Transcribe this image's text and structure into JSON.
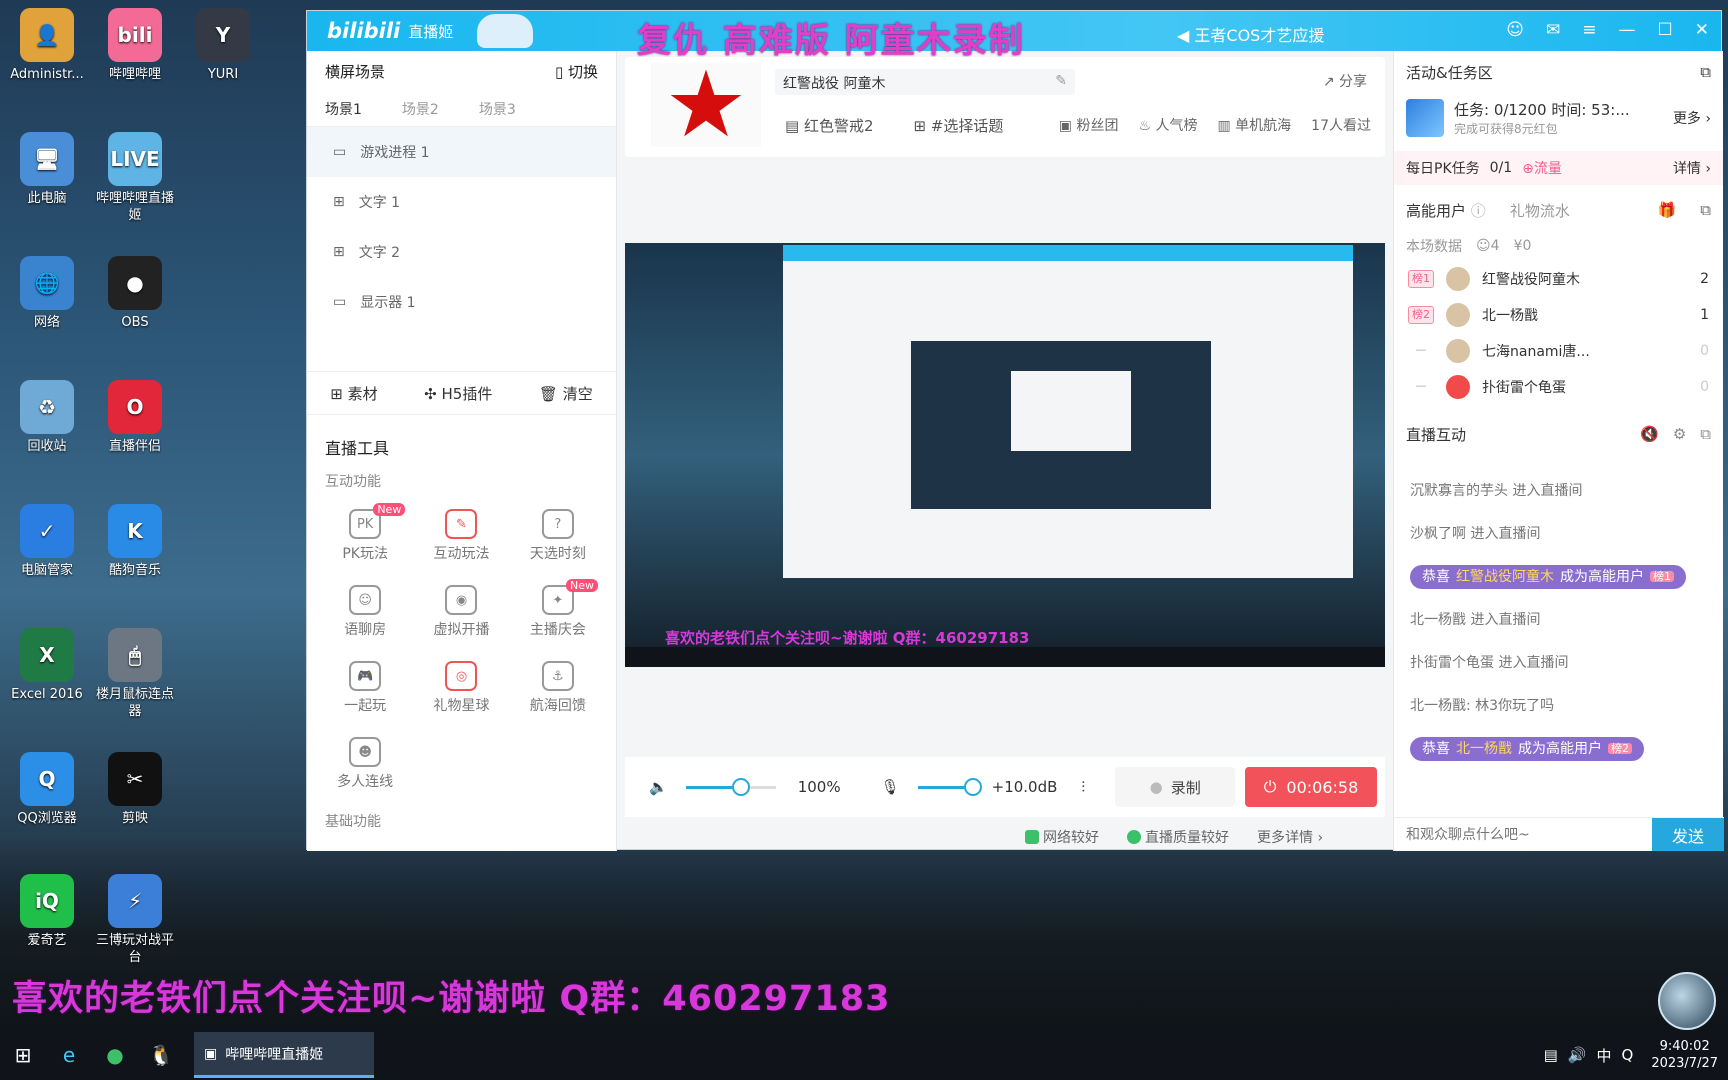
{
  "desktop": {
    "icons": [
      {
        "label": "Administr...",
        "color": "#e2a23b",
        "glyph": "👤"
      },
      {
        "label": "哔哩哔哩",
        "color": "#f36a96",
        "glyph": "bili"
      },
      {
        "label": "YURI",
        "color": "#333a46",
        "glyph": "Y"
      },
      {
        "label": "此电脑",
        "color": "#4a8ed8",
        "glyph": "🖥"
      },
      {
        "label": "哔哩哔哩直播姬",
        "color": "#5fb4e6",
        "glyph": "LIVE"
      },
      {
        "label": "网络",
        "color": "#3a84cf",
        "glyph": "🌐"
      },
      {
        "label": "OBS",
        "color": "#222222",
        "glyph": "●"
      },
      {
        "label": "回收站",
        "color": "#6fa9d6",
        "glyph": "♻"
      },
      {
        "label": "直播伴侣",
        "color": "#e3273a",
        "glyph": "O"
      },
      {
        "label": "电脑管家",
        "color": "#2a7de1",
        "glyph": "✓"
      },
      {
        "label": "酷狗音乐",
        "color": "#2a8be6",
        "glyph": "K"
      },
      {
        "label": "Excel 2016",
        "color": "#1f7a45",
        "glyph": "X"
      },
      {
        "label": "楼月鼠标连点器",
        "color": "#6d7784",
        "glyph": "🖱"
      },
      {
        "label": "QQ浏览器",
        "color": "#2b8fe8",
        "glyph": "Q"
      },
      {
        "label": "剪映",
        "color": "#111111",
        "glyph": "✂"
      },
      {
        "label": "爱奇艺",
        "color": "#1fbf4a",
        "glyph": "iQ"
      },
      {
        "label": "三博玩对战平台",
        "color": "#3c7fd8",
        "glyph": "⚡"
      }
    ],
    "promo": "喜欢的老铁们点个关注呗~谢谢啦 Q群：460297183"
  },
  "taskbar": {
    "app_label": "哔哩哔哩直播姬",
    "tray_ime": "中",
    "time": "9:40:02",
    "date": "2023/7/27"
  },
  "window": {
    "logo": "bilibili",
    "logo_sub": "直播姬",
    "overlay_title": "复仇 高难版 阿童木录制",
    "notice": "王者COS才艺应援"
  },
  "left": {
    "header": "横屏场景",
    "switch_label": "切换",
    "scene_tabs": [
      "场景1",
      "场景2",
      "场景3"
    ],
    "sources": [
      "游戏进程 1",
      "文字 1",
      "文字 2",
      "显示器 1"
    ],
    "source_actions": [
      "素材",
      "H5插件",
      "清空"
    ],
    "tools_title": "直播工具",
    "interactive_title": "互动功能",
    "tools": [
      {
        "label": "PK玩法",
        "glyph": "PK",
        "new": "New"
      },
      {
        "label": "互动玩法",
        "glyph": "✎"
      },
      {
        "label": "天选时刻",
        "glyph": "?"
      },
      {
        "label": "语聊房",
        "glyph": "☺"
      },
      {
        "label": "虚拟开播",
        "glyph": "◉"
      },
      {
        "label": "主播庆会",
        "glyph": "✦",
        "new": "New"
      },
      {
        "label": "一起玩",
        "glyph": "🎮"
      },
      {
        "label": "礼物星球",
        "glyph": "◎"
      },
      {
        "label": "航海回馈",
        "glyph": "⚓"
      },
      {
        "label": "多人连线",
        "glyph": "☻"
      }
    ],
    "basic_title": "基础功能"
  },
  "room": {
    "title": "红警战役 阿童木",
    "share": "分享",
    "category": "红色警戒2",
    "topic": "#选择话题",
    "fans": "粉丝团",
    "popularity": "人气榜",
    "voyage": "单机航海",
    "viewers": "17人看过"
  },
  "preview": {
    "promo": "喜欢的老铁们点个关注呗~谢谢啦 Q群：460297183"
  },
  "controls": {
    "volume": "100%",
    "mic_gain": "+10.0dB",
    "record": "录制",
    "live_time": "00:06:58",
    "network": "网络较好",
    "quality": "直播质量较好",
    "more": "更多详情"
  },
  "right": {
    "activity_title": "活动&任务区",
    "task_text": "任务: 0/1200 时间: 53:...",
    "task_sub": "完成可获得8元红包",
    "more": "更多",
    "pk_label": "每日PK任务",
    "pk_progress": "0/1",
    "pk_reward": "流量",
    "pk_detail": "详情",
    "tab_high": "高能用户",
    "tab_gift": "礼物流水",
    "session_label": "本场数据",
    "session_users": "4",
    "session_money": "¥0",
    "users": [
      {
        "rank": "榜1",
        "name": "红警战役阿童木",
        "count": "2"
      },
      {
        "rank": "榜2",
        "name": "北一杨戬",
        "count": "1"
      },
      {
        "rank": "—",
        "name": "七海nanami唐...",
        "count": "0"
      },
      {
        "rank": "—",
        "name": "扑街雷个龟蛋",
        "count": "0"
      }
    ],
    "interact_title": "直播互动",
    "feed": [
      {
        "type": "text",
        "text": "沉默寡言的芋头 进入直播间"
      },
      {
        "type": "text",
        "text": "沙枫了啊 进入直播间"
      },
      {
        "type": "pill",
        "pre": "恭喜",
        "hl": "红警战役阿童木",
        "post": "成为高能用户",
        "badge": "榜1"
      },
      {
        "type": "text",
        "text": "北一杨戬 进入直播间"
      },
      {
        "type": "text",
        "text": "扑街雷个龟蛋 进入直播间"
      },
      {
        "type": "text",
        "text": "北一杨戬: 林3你玩了吗"
      },
      {
        "type": "pill",
        "pre": "恭喜",
        "hl": "北一杨戬",
        "post": "成为高能用户",
        "badge": "榜2"
      }
    ],
    "input_placeholder": "和观众聊点什么吧~",
    "send": "发送"
  },
  "colors": {
    "accent": "#19b7ef",
    "live": "#f2525a",
    "promo": "#d638d9"
  }
}
